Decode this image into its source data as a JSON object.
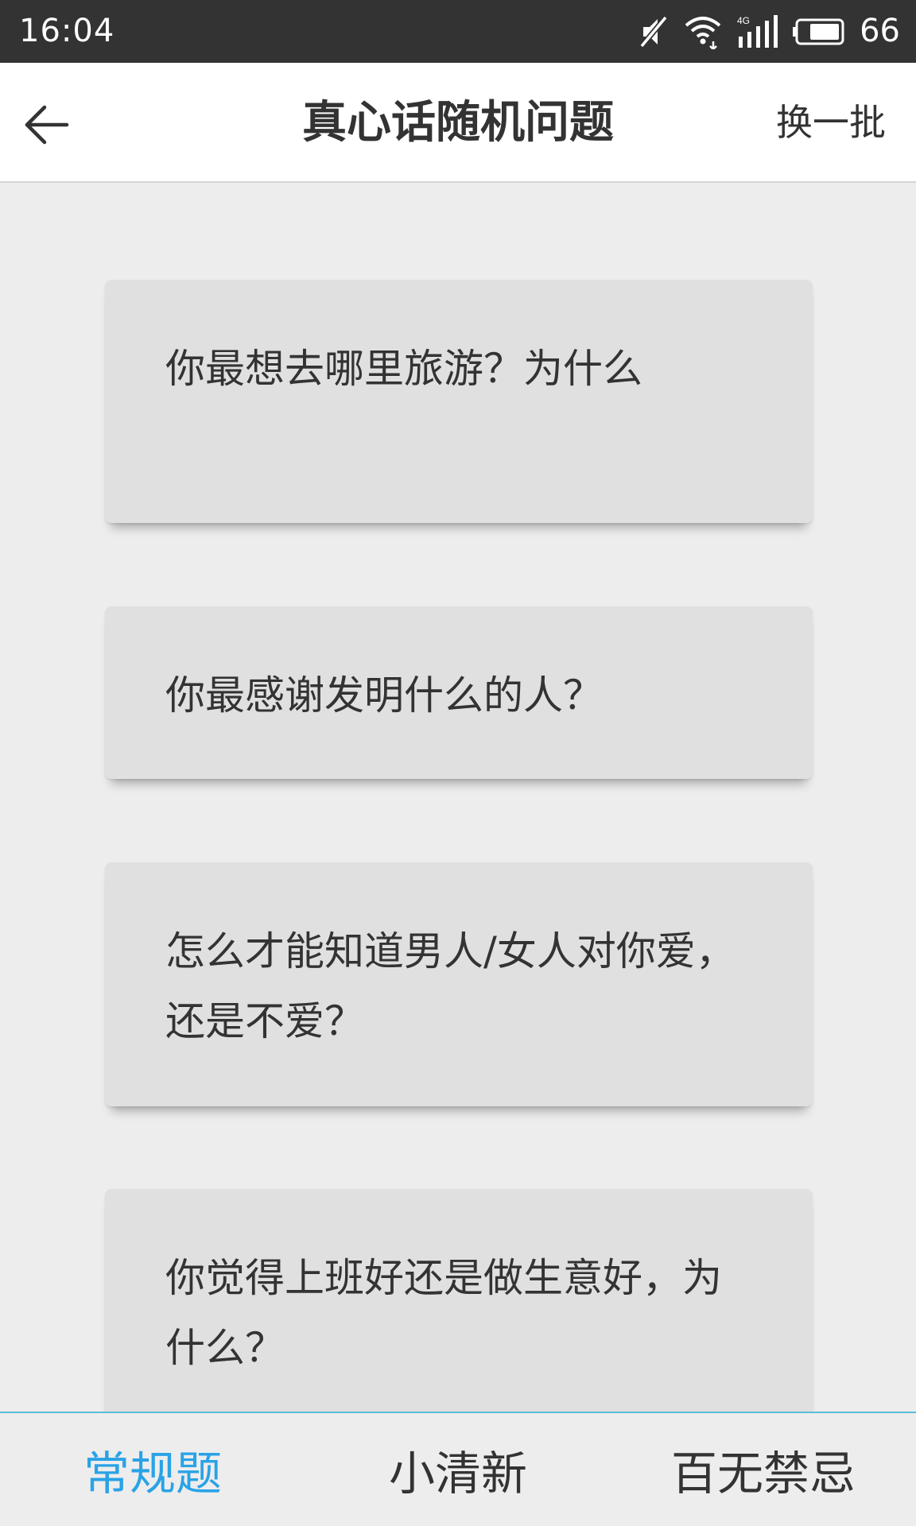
{
  "status_bar": {
    "time": "16:04",
    "network": "4G",
    "battery": "66",
    "icons": [
      "mute-icon",
      "wifi-icon",
      "signal-icon",
      "battery-icon"
    ]
  },
  "header": {
    "title": "真心话随机问题",
    "refresh_label": "换一批",
    "back_icon": "arrow-left-icon"
  },
  "cards": [
    {
      "text": "你最想去哪里旅游？为什么"
    },
    {
      "text": "你最感谢发明什么的人？"
    },
    {
      "text": "怎么才能知道男人/女人对你爱，还是不爱？"
    },
    {
      "text": "你觉得上班好还是做生意好，为什么？"
    }
  ],
  "tabs": [
    {
      "label": "常规题",
      "active": true
    },
    {
      "label": "小清新",
      "active": false
    },
    {
      "label": "百无禁忌",
      "active": false
    }
  ],
  "colors": {
    "active_tab": "#29a3e6",
    "status_bar": "#333333",
    "background": "#ededed",
    "card": "#e0e0e0"
  }
}
